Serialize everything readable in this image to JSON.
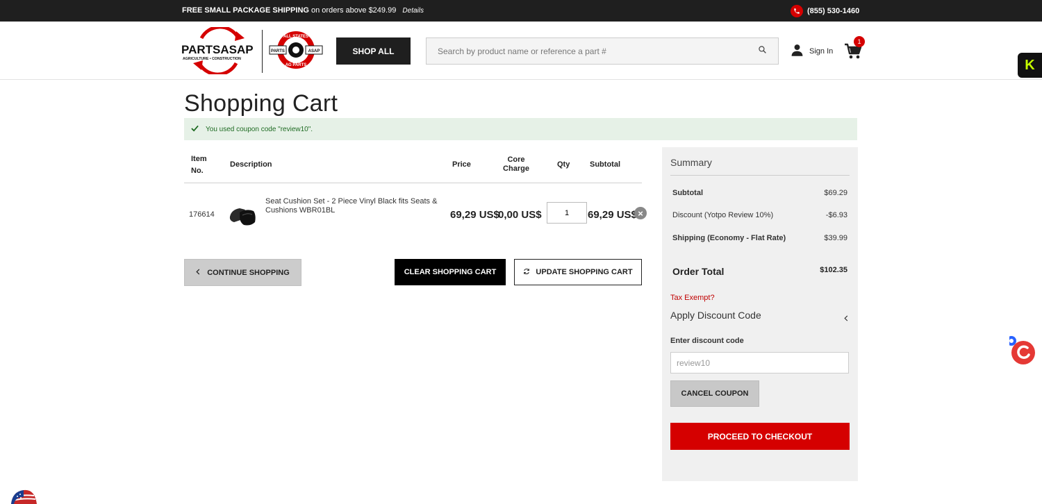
{
  "topbar": {
    "shipping_bold": "FREE SMALL PACKAGE SHIPPING",
    "shipping_rest": "on orders above $249.99",
    "details": "Details",
    "phone": "(855) 530-1460"
  },
  "header": {
    "logo_text": "PARTSASAP",
    "logo_sub": "AGRICULTURE • CONSTRUCTION",
    "logo2_top": "ALL STATES",
    "logo2_bottom": "AG PARTS",
    "logo2_left": "PARTS",
    "logo2_right": "ASAP",
    "shop_all": "SHOP ALL",
    "search_placeholder": "Search by product name or reference a part #",
    "sign_in": "Sign In",
    "cart_count": "1",
    "widget_letter": "K"
  },
  "page": {
    "title": "Shopping Cart",
    "notice": "You used coupon code \"review10\"."
  },
  "table": {
    "headers": {
      "item_no": "Item No.",
      "description": "Description",
      "price": "Price",
      "core_charge": "Core Charge",
      "qty": "Qty",
      "subtotal": "Subtotal"
    },
    "rows": [
      {
        "item_no": "176614",
        "description": "Seat Cushion Set - 2 Piece Vinyl Black fits Seats & Cushions WBR01BL",
        "price": "69,29 US$",
        "core_charge": "0,00 US$",
        "qty": "1",
        "subtotal": "69,29 US$"
      }
    ]
  },
  "actions": {
    "continue": "CONTINUE SHOPPING",
    "clear": "CLEAR SHOPPING CART",
    "update": "UPDATE SHOPPING CART"
  },
  "summary": {
    "title": "Summary",
    "subtotal_label": "Subtotal",
    "subtotal_value": "$69.29",
    "discount_label": "Discount (Yotpo Review 10%)",
    "discount_value": "-$6.93",
    "shipping_label": "Shipping (Economy - Flat Rate)",
    "shipping_value": "$39.99",
    "order_total_label": "Order Total",
    "order_total_value": "$102.35",
    "tax_exempt": "Tax Exempt?",
    "apply_discount": "Apply Discount Code",
    "enter_code_label": "Enter discount code",
    "code_value": "review10",
    "cancel_coupon": "CANCEL COUPON",
    "checkout": "PROCEED TO CHECKOUT"
  },
  "colors": {
    "brand_red": "#d50000",
    "dark": "#1f1f1f",
    "success_bg": "#e6f1e7",
    "success_text": "#1e6b22"
  }
}
